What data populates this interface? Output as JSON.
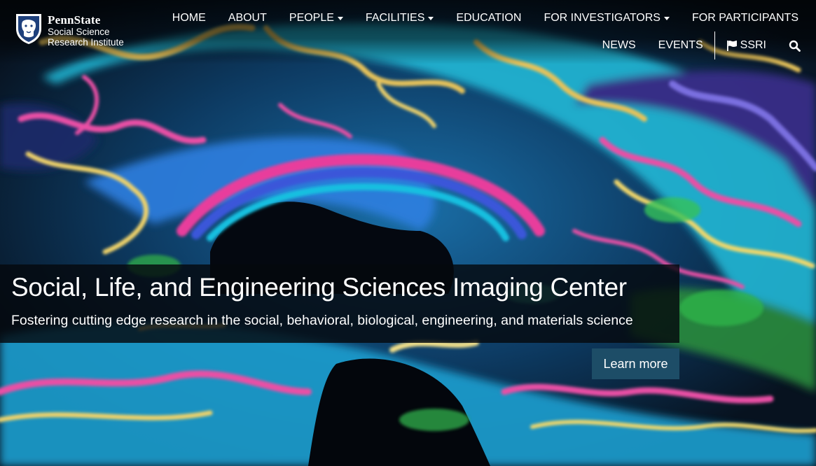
{
  "logo": {
    "brand": "PennState",
    "line1": "Social Science",
    "line2": "Research Institute",
    "icon": "nittany-lion-shield-icon"
  },
  "nav": {
    "primary": [
      {
        "label": "HOME",
        "dropdown": false
      },
      {
        "label": "ABOUT",
        "dropdown": false
      },
      {
        "label": "PEOPLE",
        "dropdown": true
      },
      {
        "label": "FACILITIES",
        "dropdown": true
      },
      {
        "label": "EDUCATION",
        "dropdown": false
      },
      {
        "label": "FOR INVESTIGATORS",
        "dropdown": true
      },
      {
        "label": "FOR PARTICIPANTS",
        "dropdown": false
      }
    ],
    "secondary": {
      "news": "NEWS",
      "events": "EVENTS",
      "ssri": "SSRI",
      "ssri_icon": "flag-icon",
      "search_icon": "search-icon"
    }
  },
  "hero": {
    "title": "Social, Life, and Engineering Sciences Imaging Center",
    "subtitle": "Fostering cutting edge research in the social, behavioral, biological, engineering, and materials science",
    "button": "Learn more"
  },
  "colors": {
    "button_bg": "#1d4d67",
    "caption_bg": "#05080e",
    "text": "#ffffff"
  }
}
